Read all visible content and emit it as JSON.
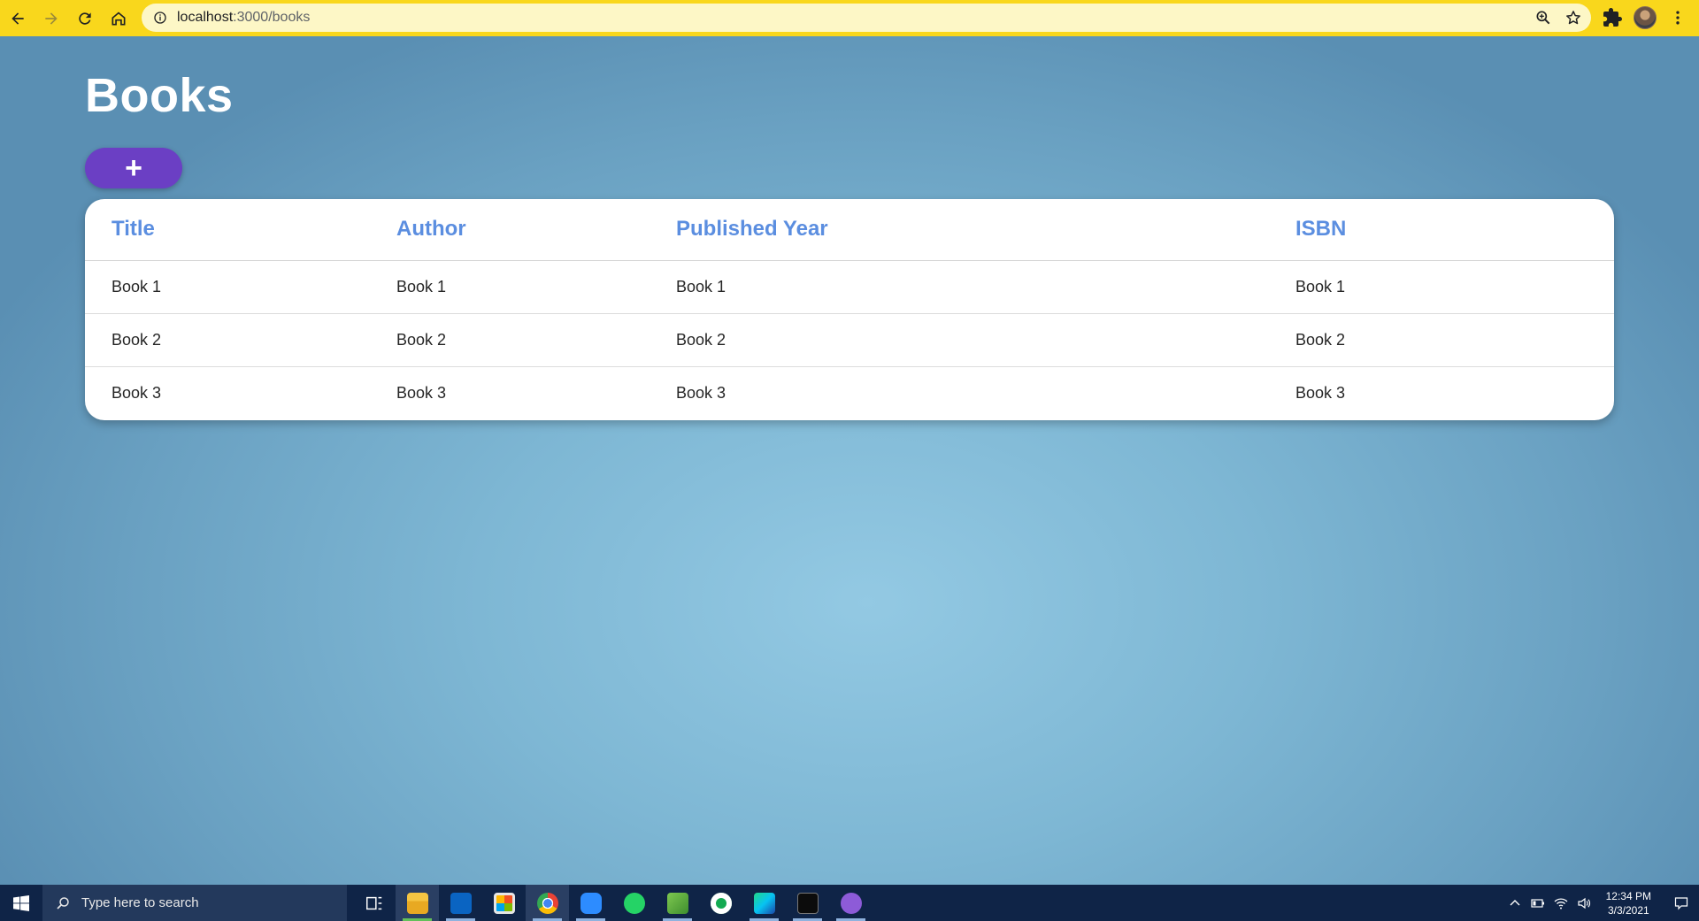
{
  "browser": {
    "url_host": "localhost",
    "url_path": ":3000/books"
  },
  "page": {
    "title": "Books",
    "add_button_label": "+"
  },
  "table": {
    "headers": [
      "Title",
      "Author",
      "Published Year",
      "ISBN"
    ],
    "rows": [
      [
        "Book 1",
        "Book 1",
        "Book 1",
        "Book 1"
      ],
      [
        "Book 2",
        "Book 2",
        "Book 2",
        "Book 2"
      ],
      [
        "Book 3",
        "Book 3",
        "Book 3",
        "Book 3"
      ]
    ]
  },
  "taskbar": {
    "search_placeholder": "Type here to search",
    "time": "12:34 PM",
    "date": "3/3/2021",
    "apps": [
      "task-view",
      "file-explorer",
      "outlook",
      "microsoft-store",
      "chrome",
      "zoom",
      "whatsapp",
      "notepad",
      "mongodb-compass",
      "webstorm",
      "terminal",
      "github-desktop"
    ]
  },
  "colors": {
    "chrome_bar": "#f9d71c",
    "accent_button": "#6b3fc4",
    "header_text": "#5b8ee0",
    "taskbar": "#0f2447"
  }
}
